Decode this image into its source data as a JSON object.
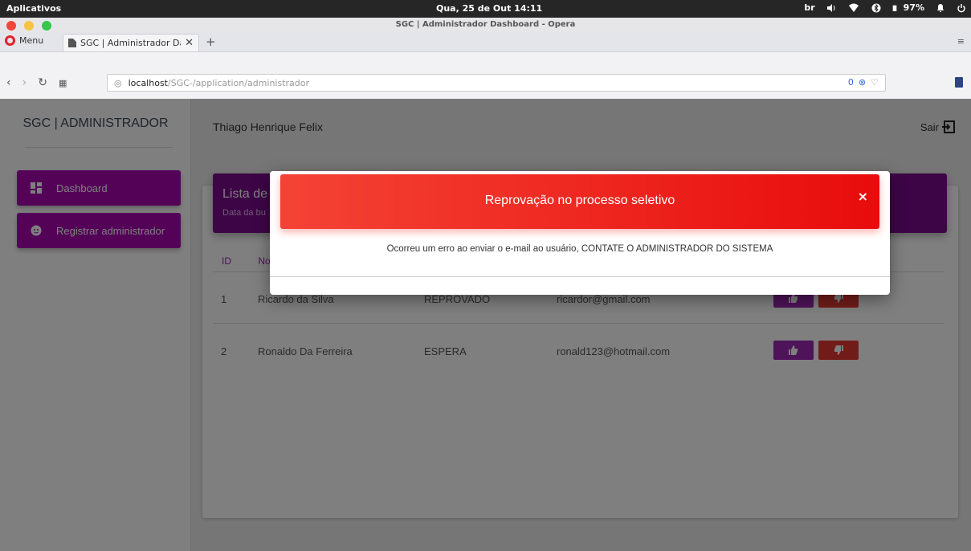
{
  "os": {
    "apps_label": "Aplicativos",
    "clock": "Qua, 25 de Out  14:11",
    "keyboard_layout": "br",
    "battery": "97%"
  },
  "browser": {
    "window_title": "SGC | Administrador Dashboard - Opera",
    "menu_label": "Menu",
    "tab_title": "SGC | Administrador Da",
    "url_host": "localhost",
    "url_path": "/SGC-/application/administrador",
    "blocked_count": "0",
    "traffic_colors": [
      "#f0473a",
      "#f6c342",
      "#34c74a"
    ]
  },
  "sidebar": {
    "brand": "SGC | ADMINISTRADOR",
    "items": [
      {
        "label": "Dashboard",
        "icon": "dashboard-icon"
      },
      {
        "label": "Registrar administrador",
        "icon": "face-icon"
      }
    ],
    "accent_color": "#a805b1"
  },
  "header": {
    "user_name": "Thiago Henrique Felix",
    "logout_label": "Sair"
  },
  "card": {
    "title": "Lista de",
    "subtitle": "Data da bu",
    "columns": [
      "ID",
      "No"
    ],
    "rows": [
      {
        "id": "1",
        "name": "Ricardo da Silva",
        "status": "REPROVADO",
        "email": "ricardor@gmail.com"
      },
      {
        "id": "2",
        "name": "Ronaldo Da Ferreira",
        "status": "ESPERA",
        "email": "ronald123@hotmail.com"
      }
    ]
  },
  "modal": {
    "title": "Reprovação no processo seletivo",
    "close_label": "×",
    "message": "Ocorreu um erro ao enviar o e-mail ao usuário, CONTATE O ADMINISTRADOR DO SISTEMA",
    "header_color": "#f44336"
  }
}
